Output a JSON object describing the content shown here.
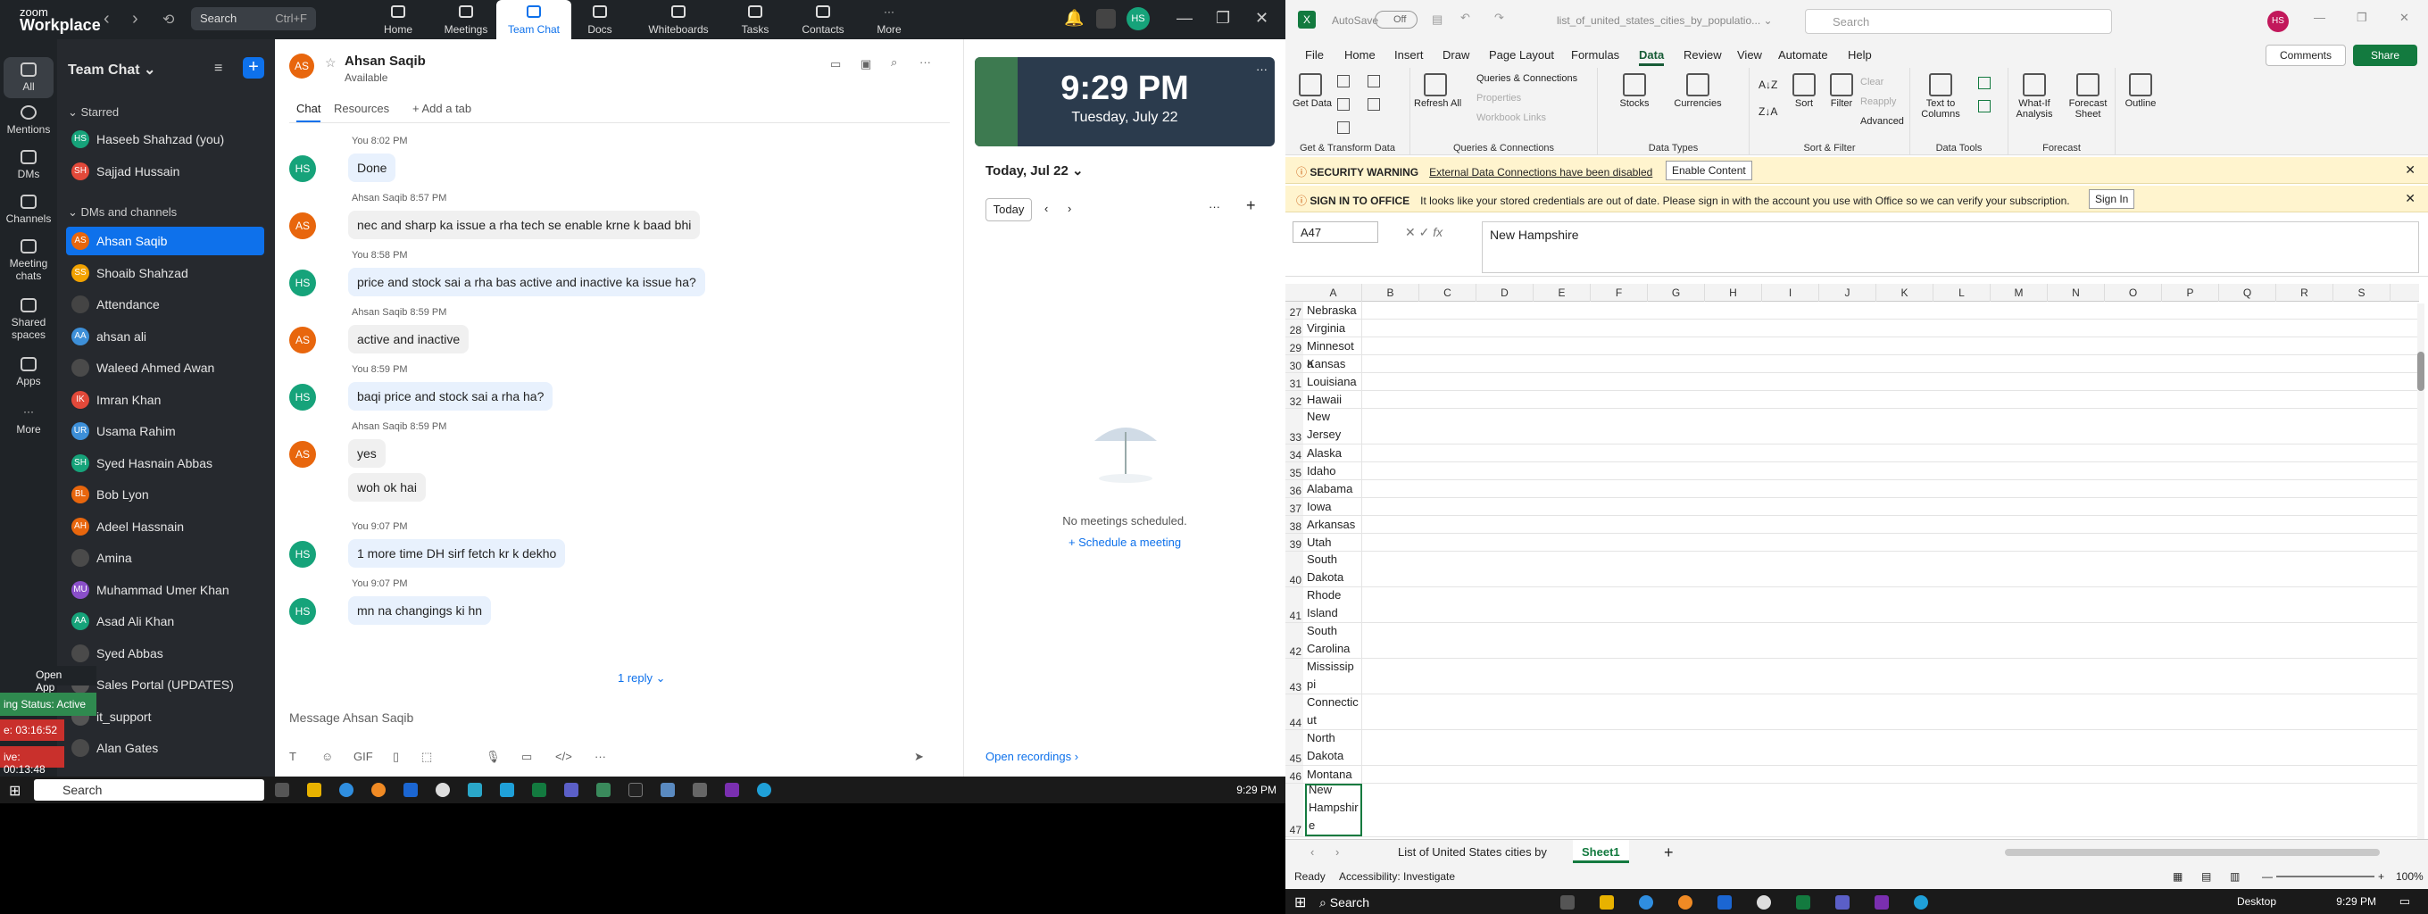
{
  "zoom": {
    "logo_line1": "zoom",
    "logo_line2": "Workplace",
    "search_placeholder": "Search",
    "search_shortcut": "Ctrl+F",
    "tabs": [
      "Home",
      "Meetings",
      "Team Chat",
      "Docs",
      "Whiteboards",
      "Tasks",
      "Contacts",
      "More"
    ],
    "avatar": "HS",
    "rail": [
      "All",
      "Mentions",
      "DMs",
      "Channels",
      "Meeting chats",
      "Shared spaces",
      "Apps",
      "More"
    ],
    "sidebar_title": "Team Chat",
    "starred_label": "Starred",
    "dms_label": "DMs and channels",
    "starred": [
      {
        "initials": "HS",
        "name": "Haseeb Shahzad (you)",
        "color": "#16a37a"
      },
      {
        "initials": "SH",
        "name": "Sajjad Hussain",
        "color": "#e2493a"
      }
    ],
    "dms": [
      {
        "initials": "AS",
        "name": "Ahsan Saqib",
        "color": "#e8660d"
      },
      {
        "initials": "SS",
        "name": "Shoaib Shahzad",
        "color": "#f2a200"
      },
      {
        "initials": "",
        "name": "Attendance",
        "color": "#444"
      },
      {
        "initials": "AA",
        "name": "ahsan ali",
        "color": "#3d8fd8"
      },
      {
        "initials": "",
        "name": "Waleed Ahmed Awan",
        "color": "#4a4a4a"
      },
      {
        "initials": "IK",
        "name": "Imran Khan",
        "color": "#e2493a"
      },
      {
        "initials": "UR",
        "name": "Usama Rahim",
        "color": "#3d8fd8"
      },
      {
        "initials": "SH",
        "name": "Syed Hasnain Abbas",
        "color": "#16a37a"
      },
      {
        "initials": "BL",
        "name": "Bob Lyon",
        "color": "#e8660d"
      },
      {
        "initials": "AH",
        "name": "Adeel Hassnain",
        "color": "#e8660d"
      },
      {
        "initials": "",
        "name": "Amina",
        "color": "#4a4a4a"
      },
      {
        "initials": "MU",
        "name": "Muhammad Umer Khan",
        "color": "#8a4fc9"
      },
      {
        "initials": "AA",
        "name": "Asad Ali Khan",
        "color": "#16a37a"
      },
      {
        "initials": "",
        "name": "Syed Abbas",
        "color": "#4a4a4a"
      },
      {
        "initials": "",
        "name": "Sales Portal (UPDATES)",
        "color": "#555"
      },
      {
        "initials": "",
        "name": "it_support",
        "color": "#555"
      },
      {
        "initials": "",
        "name": "Alan Gates",
        "color": "#4a4a4a"
      }
    ],
    "open_app": "Open App ↗",
    "status_active": "ing Status: Active",
    "timer1": "e: 03:16:52",
    "timer2": "ive: 00:13:48",
    "chat_name": "Ahsan Saqib",
    "chat_status": "Available",
    "chat_initials": "AS",
    "chat_tabs": [
      "Chat",
      "Resources",
      "+ Add a tab"
    ],
    "messages": [
      {
        "who": "HS",
        "meta": "You 8:02 PM",
        "text": "Done",
        "me": true
      },
      {
        "who": "AS",
        "meta": "Ahsan Saqib 8:57 PM",
        "text": "nec and sharp ka issue a rha tech se enable krne k baad bhi",
        "me": false
      },
      {
        "who": "HS",
        "meta": "You 8:58 PM",
        "text": "price and stock sai a rha bas active and inactive ka issue ha?",
        "me": true
      },
      {
        "who": "AS",
        "meta": "Ahsan Saqib 8:59 PM",
        "text": "active and inactive",
        "me": false
      },
      {
        "who": "HS",
        "meta": "You 8:59 PM",
        "text": "baqi price and stock sai a rha ha?",
        "me": true
      },
      {
        "who": "AS",
        "meta": "Ahsan Saqib 8:59 PM",
        "text": "yes",
        "me": false
      },
      {
        "who": "",
        "meta": "",
        "text": "woh ok hai",
        "me": false
      },
      {
        "who": "HS",
        "meta": "You 9:07 PM",
        "text": "1 more time DH sirf fetch kr k dekho",
        "me": true
      },
      {
        "who": "HS",
        "meta": "You 9:07 PM",
        "text": "mn na changings ki hn",
        "me": true
      }
    ],
    "reply_label": "1 reply",
    "input_placeholder": "Message Ahsan Saqib",
    "clock_time": "9:29 PM",
    "clock_date": "Tuesday, July 22",
    "cal_date": "Today, Jul 22",
    "today_btn": "Today",
    "no_meetings": "No meetings scheduled.",
    "schedule": "+ Schedule a meeting",
    "recordings": "Open recordings ›",
    "taskbar_search": "Search",
    "taskbar_time": "9:29 PM"
  },
  "excel": {
    "autosave": "AutoSave",
    "toggle": "Off",
    "filename": "list_of_united_states_cities_by_populatio... ⌄",
    "search": "Search",
    "avatar": "HS",
    "menu": [
      "File",
      "Home",
      "Insert",
      "Draw",
      "Page Layout",
      "Formulas",
      "Data",
      "Review",
      "View",
      "Automate",
      "Help"
    ],
    "comments": "Comments",
    "share": "Share",
    "ribbon": {
      "get_data": "Get Data",
      "refresh": "Refresh All",
      "queries": "Queries & Connections",
      "properties": "Properties",
      "workbook_links": "Workbook Links",
      "stocks": "Stocks",
      "currencies": "Currencies",
      "sort": "Sort",
      "filter": "Filter",
      "clear": "Clear",
      "reapply": "Reapply",
      "advanced": "Advanced",
      "text_to_columns": "Text to Columns",
      "what_if": "What-If Analysis",
      "forecast_sheet": "Forecast Sheet",
      "outline": "Outline",
      "g1": "Get & Transform Data",
      "g2": "Queries & Connections",
      "g3": "Data Types",
      "g4": "Sort & Filter",
      "g5": "Data Tools",
      "g6": "Forecast"
    },
    "warn1_title": "SECURITY WARNING",
    "warn1_text": "External Data Connections have been disabled",
    "warn1_btn": "Enable Content",
    "warn2_title": "SIGN IN TO OFFICE",
    "warn2_text": "It looks like your stored credentials are out of date. Please sign in with the account you use with Office so we can verify your subscription.",
    "warn2_btn": "Sign In",
    "namebox": "A47",
    "formula": "New Hampshire",
    "columns": [
      "A",
      "B",
      "C",
      "D",
      "E",
      "F",
      "G",
      "H",
      "I",
      "J",
      "K",
      "L",
      "M",
      "N",
      "O",
      "P",
      "Q",
      "R",
      "S"
    ],
    "rows": [
      {
        "n": "27",
        "v": "Nebraska",
        "h": 20
      },
      {
        "n": "28",
        "v": "Virginia",
        "h": 20
      },
      {
        "n": "29",
        "v": "Minnesota",
        "h": 20
      },
      {
        "n": "30",
        "v": "Kansas",
        "h": 20
      },
      {
        "n": "31",
        "v": "Louisiana",
        "h": 20
      },
      {
        "n": "32",
        "v": "Hawaii",
        "h": 20
      },
      {
        "n": "33",
        "v": "New Jersey",
        "h": 40
      },
      {
        "n": "34",
        "v": "Alaska",
        "h": 20
      },
      {
        "n": "35",
        "v": "Idaho",
        "h": 20
      },
      {
        "n": "36",
        "v": "Alabama",
        "h": 20
      },
      {
        "n": "37",
        "v": "Iowa",
        "h": 20
      },
      {
        "n": "38",
        "v": "Arkansas",
        "h": 20
      },
      {
        "n": "39",
        "v": "Utah",
        "h": 20
      },
      {
        "n": "40",
        "v": "South Dakota",
        "h": 40
      },
      {
        "n": "41",
        "v": "Rhode Island",
        "h": 40
      },
      {
        "n": "42",
        "v": "South Carolina",
        "h": 40
      },
      {
        "n": "43",
        "v": "Mississippi",
        "h": 40
      },
      {
        "n": "44",
        "v": "Connecticut",
        "h": 40
      },
      {
        "n": "45",
        "v": "North Dakota",
        "h": 40
      },
      {
        "n": "46",
        "v": "Montana",
        "h": 20
      },
      {
        "n": "47",
        "v": "New Hampshire",
        "h": 60
      }
    ],
    "sheet1": "List of United States cities by",
    "sheet2": "Sheet1",
    "status_ready": "Ready",
    "accessibility": "Accessibility: Investigate",
    "zoom": "100%",
    "taskbar_search": "Search",
    "desktop": "Desktop",
    "taskbar_time": "9:29 PM"
  }
}
